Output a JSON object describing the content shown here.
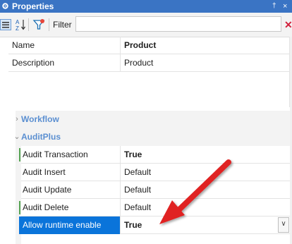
{
  "window": {
    "title": "Properties",
    "pin_glyph": "†",
    "close_glyph": "×"
  },
  "toolbar": {
    "categorized_glyph": "☰",
    "sort_glyph": "A↓",
    "filter_glyph": "▼",
    "filter_label": "Filter",
    "filter_value": "",
    "clear_glyph": "✕"
  },
  "top_rows": [
    {
      "name": "Name",
      "value": "Product"
    },
    {
      "name": "Description",
      "value": "Product"
    }
  ],
  "categories": [
    {
      "label": "Workflow",
      "chevron": "›"
    },
    {
      "label": "AuditPlus",
      "chevron": "⌄"
    }
  ],
  "audit_rows": [
    {
      "name": "Audit Transaction",
      "value": "True"
    },
    {
      "name": "Audit Insert",
      "value": "Default"
    },
    {
      "name": "Audit Update",
      "value": "Default"
    },
    {
      "name": "Audit Delete",
      "value": "Default"
    },
    {
      "name": "Allow runtime enable",
      "value": "True"
    }
  ],
  "dropdown_glyph": "∨",
  "colors": {
    "accent": "#3a74c4",
    "selection": "#0a74da",
    "category": "#5b8fd1",
    "arrow": "#e02020",
    "marker": "#55a352"
  }
}
